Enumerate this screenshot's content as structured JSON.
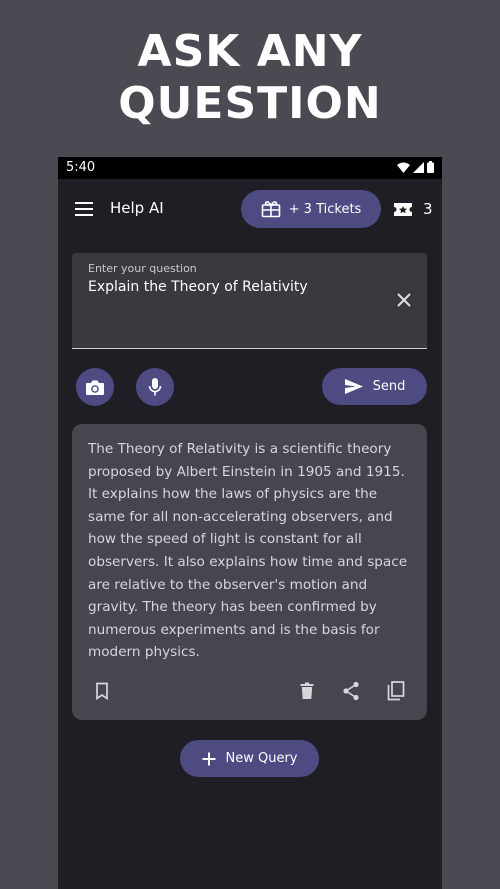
{
  "promo": {
    "line1": "ASK ANY",
    "line2": "QUESTION"
  },
  "status_bar": {
    "time": "5:40",
    "icons": [
      "wifi-icon",
      "signal-icon",
      "battery-icon"
    ]
  },
  "app_bar": {
    "title": "Help AI",
    "tickets_button_label": "+ 3 Tickets",
    "ticket_count": "3",
    "icons": [
      "menu-icon",
      "gift-icon",
      "ticket-icon"
    ]
  },
  "question": {
    "label": "Enter your question",
    "value": "Explain the Theory of Relativity"
  },
  "actions": {
    "send_label": "Send",
    "icons": [
      "camera-icon",
      "mic-icon",
      "send-icon"
    ]
  },
  "answer": {
    "text": "The Theory of Relativity is a scientific theory proposed by Albert Einstein in 1905 and 1915. It explains how the laws of physics are the same for all non-accelerating observers, and how the speed of light is constant for all observers. It also explains how time and space are relative to the observer's motion and gravity. The theory has been confirmed by numerous experiments and is the basis for modern physics.",
    "icons": [
      "bookmark-icon",
      "delete-icon",
      "share-icon",
      "copy-icon"
    ]
  },
  "new_query_label": "New Query",
  "colors": {
    "accent": "#4e4a82",
    "background": "#1f1e24",
    "card": "#48454e",
    "outer": "#4a4a52"
  }
}
